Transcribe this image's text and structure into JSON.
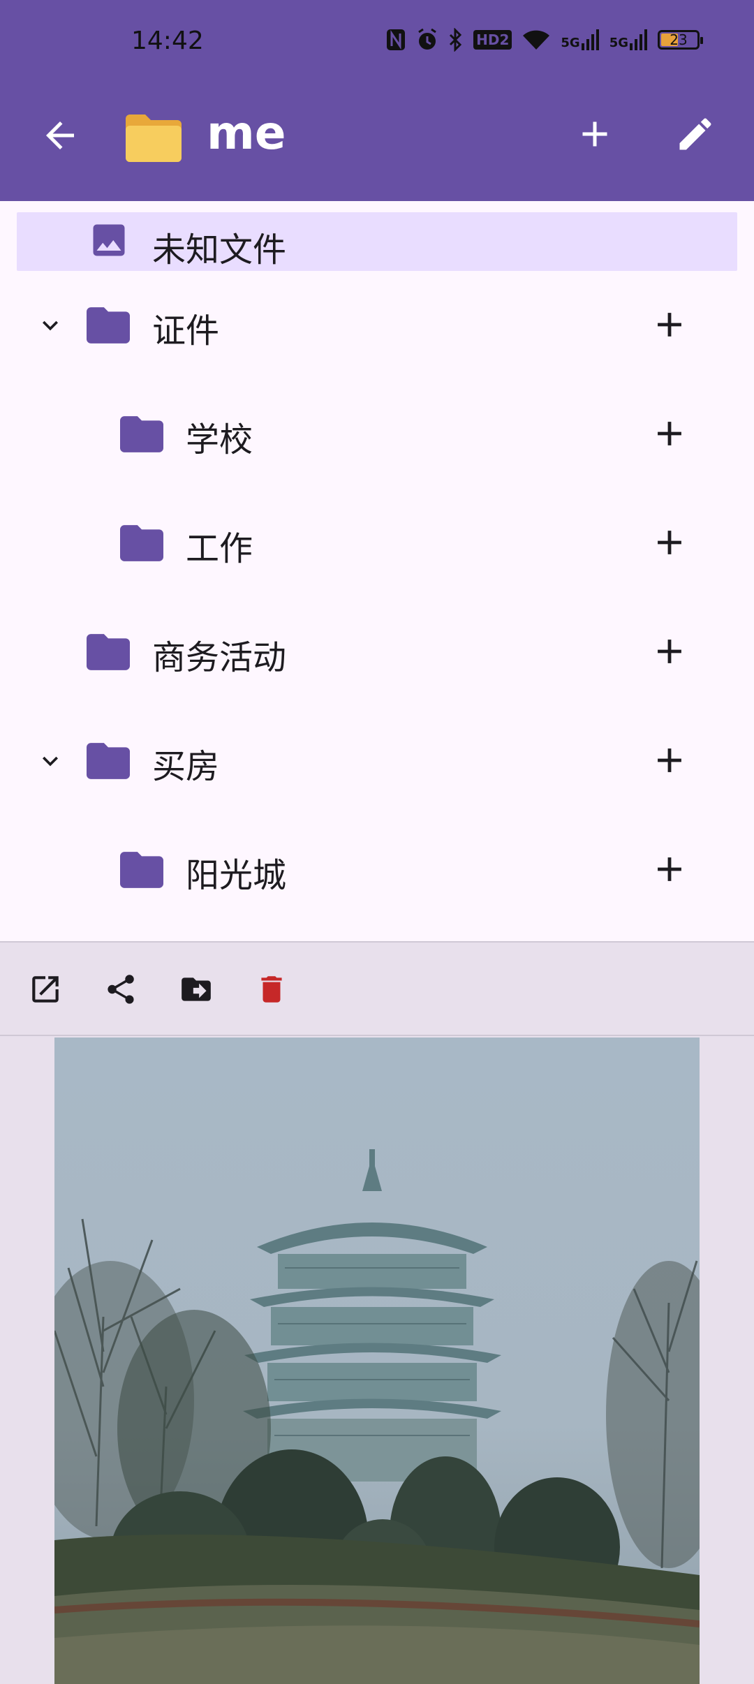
{
  "status_bar": {
    "time": "14:42",
    "icons": [
      "nfc-icon",
      "alarm-icon",
      "bluetooth-icon",
      "hd-icon",
      "wifi-icon",
      "5g-signal-icon",
      "5g-signal-icon"
    ],
    "hd_label": "HD2",
    "signal1_label": "5G",
    "signal2_label": "5G",
    "battery": "23"
  },
  "app_bar": {
    "title": "me",
    "folder_emoji": "folder-emoji-icon",
    "background": "#6750A4"
  },
  "tree": {
    "items": [
      {
        "label": "未知文件",
        "icon": "image-icon",
        "selected": true
      },
      {
        "label": "证件",
        "icon": "folder-icon",
        "expanded": true
      },
      {
        "label": "学校",
        "icon": "folder-icon"
      },
      {
        "label": "工作",
        "icon": "folder-icon"
      },
      {
        "label": "商务活动",
        "icon": "folder-icon"
      },
      {
        "label": "买房",
        "icon": "folder-icon",
        "expanded": true
      },
      {
        "label": "阳光城",
        "icon": "folder-icon"
      }
    ]
  },
  "toolbar": {
    "actions": [
      "open-external-icon",
      "share-icon",
      "move-icon",
      "delete-icon"
    ],
    "delete_color": "#C62828"
  },
  "colors": {
    "accent": "#6750A4",
    "folder": "#6750A4",
    "selected_bg": "#E9DDFF"
  }
}
